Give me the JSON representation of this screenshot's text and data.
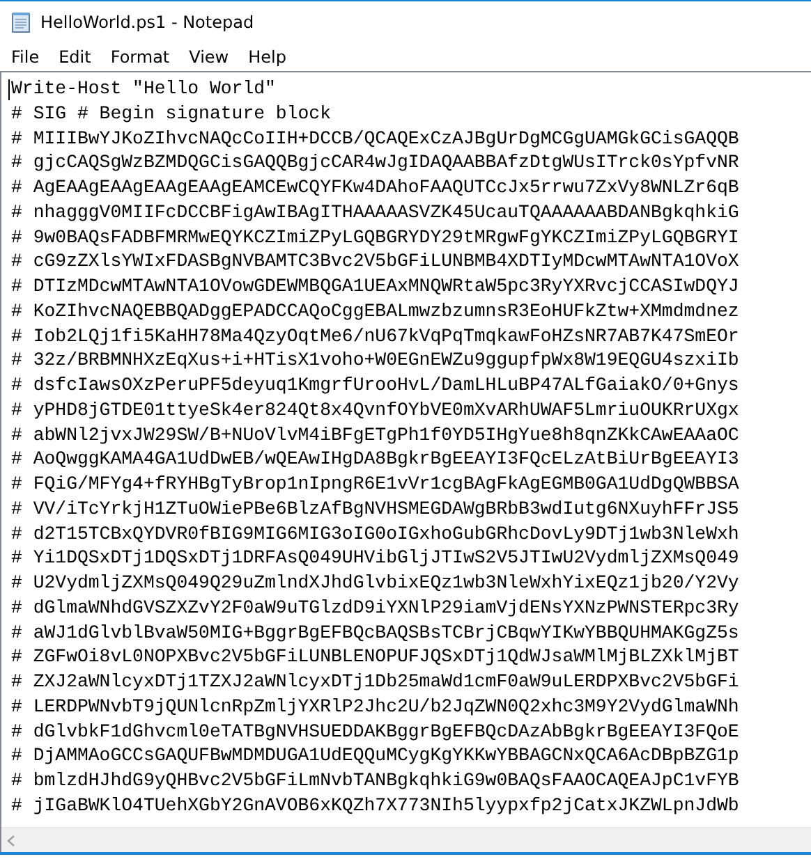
{
  "window": {
    "title": "HelloWorld.ps1 - Notepad"
  },
  "menu": [
    {
      "label": "File"
    },
    {
      "label": "Edit"
    },
    {
      "label": "Format"
    },
    {
      "label": "View"
    },
    {
      "label": "Help"
    }
  ],
  "editor": {
    "lines": [
      "Write-Host \"Hello World\"",
      "# SIG # Begin signature block",
      "# MIIIBwYJKoZIhvcNAQcCoIIH+DCCB/QCAQExCzAJBgUrDgMCGgUAMGkGCisGAQQB",
      "# gjcCAQSgWzBZMDQGCisGAQQBgjcCAR4wJgIDAQAABBAfzDtgWUsITrck0sYpfvNR",
      "# AgEAAgEAAgEAAgEAAgEAMCEwCQYFKw4DAhoFAAQUTCcJx5rrwu7ZxVy8WNLZr6qB",
      "# nhagggV0MIIFcDCCBFigAwIBAgITHAAAAASVZK45UcauTQAAAAAABDANBgkqhkiG",
      "# 9w0BAQsFADBFMRMwEQYKCZImiZPyLGQBGRYDY29tMRgwFgYKCZImiZPyLGQBGRYI",
      "# cG9zZXlsYWIxFDASBgNVBAMTC3Bvc2V5bGFiLUNBMB4XDTIyMDcwMTAwNTA1OVoX",
      "# DTIzMDcwMTAwNTA1OVowGDEWMBQGA1UEAxMNQWRtaW5pc3RyYXRvcjCCASIwDQYJ",
      "# KoZIhvcNAQEBBQADggEPADCCAQoCggEBALmwzbzumnsR3EoHUFkZtw+XMmdmdnez",
      "# Iob2LQj1fi5KaHH78Ma4QzyOqtMe6/nU67kVqPqTmqkawFoHZsNR7AB7K47SmEOr",
      "# 32z/BRBMNHXzEqXus+i+HTisX1voho+W0EGnEWZu9ggupfpWx8W19EQGU4szxiIb",
      "# dsfcIawsOXzPeruPF5deyuq1KmgrfUrooHvL/DamLHLuBP47ALfGaiakO/0+Gnys",
      "# yPHD8jGTDE01ttyeSk4er824Qt8x4QvnfOYbVE0mXvARhUWAF5LmriuOUKRrUXgx",
      "# abWNl2jvxJW29SW/B+NUoVlvM4iBFgETgPh1f0YD5IHgYue8h8qnZKkCAwEAAaOC",
      "# AoQwggKAMA4GA1UdDwEB/wQEAwIHgDA8BgkrBgEEAYI3FQcELzAtBiUrBgEEAYI3",
      "# FQiG/MFYg4+fRYHBgTyBrop1nIpngR6E1vVr1cgBAgFkAgEGMB0GA1UdDgQWBBSA",
      "# VV/iTcYrkjH1ZTuOWiePBe6BlzAfBgNVHSMEGDAWgBRbB3wdIutg6NXuyhFFrJS5",
      "# d2T15TCBxQYDVR0fBIG9MIG6MIG3oIG0oIGxhoGubGRhcDovLy9DTj1wb3NleWxh",
      "# Yi1DQSxDTj1DQSxDTj1DRFAsQ049UHVibGljJTIwS2V5JTIwU2VydmljZXMsQ049",
      "# U2VydmljZXMsQ049Q29uZmlndXJhdGlvbixEQz1wb3NleWxhYixEQz1jb20/Y2Vy",
      "# dGlmaWNhdGVSZXZvY2F0aW9uTGlzdD9iYXNlP29iamVjdENsYXNzPWNSTERpc3Ry",
      "# aWJ1dGlvblBvaW50MIG+BggrBgEFBQcBAQSBsTCBrjCBqwYIKwYBBQUHMAKGgZ5s",
      "# ZGFwOi8vL0NOPXBvc2V5bGFiLUNBLENOPUFJQSxDTj1QdWJsaWMlMjBLZXklMjBT",
      "# ZXJ2aWNlcyxDTj1TZXJ2aWNlcyxDTj1Db25maWd1cmF0aW9uLERDPXBvc2V5bGFi",
      "# LERDPWNvbT9jQUNlcnRpZmljYXRlP2Jhc2U/b2JqZWN0Q2xhc3M9Y2VydGlmaWNh",
      "# dGlvbkF1dGhvcml0eTATBgNVHSUEDDAKBggrBgEFBQcDAzAbBgkrBgEEAYI3FQoE",
      "# DjAMMAoGCCsGAQUFBwMDMDUGA1UdEQQuMCygKgYKKwYBBAGCNxQCA6AcDBpBZG1p",
      "# bmlzdHJhdG9yQHBvc2V5bGFiLmNvbTANBgkqhkiG9w0BAQsFAAOCAQEAJpC1vFYB",
      "# jIGaBWKlO4TUehXGbY2GnAVOB6xKQZh7X773NIh5lyypxfp2jCatxJKZWLpnJdWb"
    ]
  }
}
